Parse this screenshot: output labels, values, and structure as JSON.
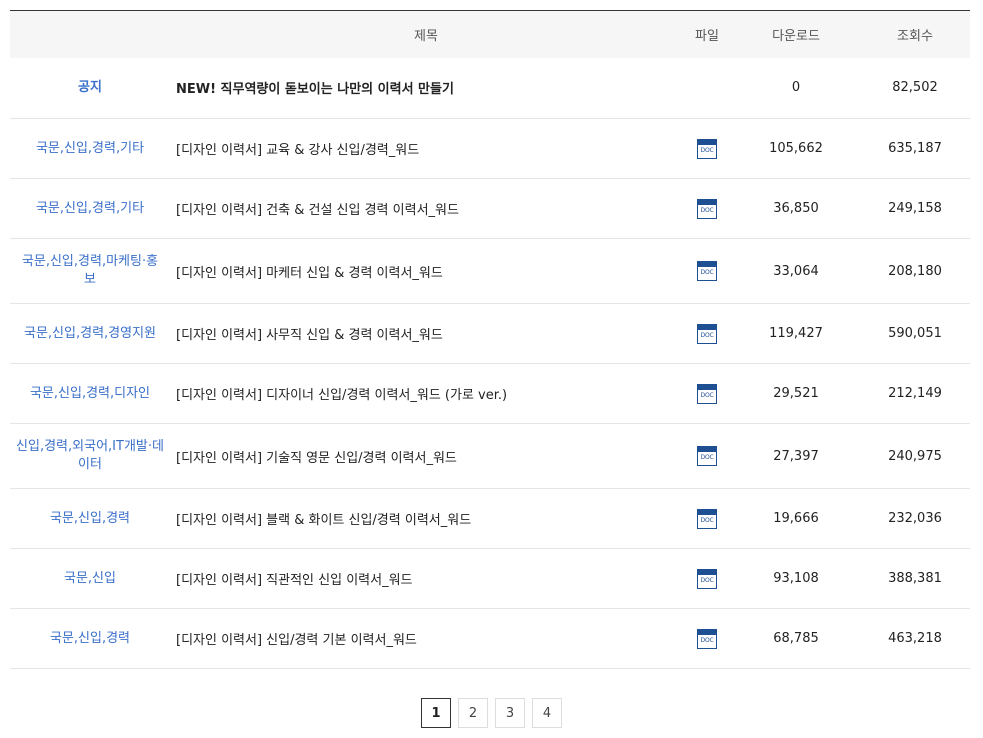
{
  "header": {
    "title": "제목",
    "file": "파일",
    "downloads": "다운로드",
    "views": "조회수"
  },
  "rows": [
    {
      "category": "공지",
      "title": "NEW! 직무역량이 돋보이는 나만의 이력서 만들기",
      "file": "",
      "downloads": "0",
      "views": "82,502"
    },
    {
      "category": "국문,신입,경력,기타",
      "title": "[디자인 이력서] 교육 & 강사 신입/경력_워드",
      "file": "DOC",
      "downloads": "105,662",
      "views": "635,187"
    },
    {
      "category": "국문,신입,경력,기타",
      "title": "[디자인 이력서] 건축 & 건설 신입 경력 이력서_워드",
      "file": "DOC",
      "downloads": "36,850",
      "views": "249,158"
    },
    {
      "category": "국문,신입,경력,마케팅·홍보",
      "title": "[디자인 이력서] 마케터 신입 & 경력 이력서_워드",
      "file": "DOC",
      "downloads": "33,064",
      "views": "208,180"
    },
    {
      "category": "국문,신입,경력,경영지원",
      "title": "[디자인 이력서] 사무직 신입 & 경력 이력서_워드",
      "file": "DOC",
      "downloads": "119,427",
      "views": "590,051"
    },
    {
      "category": "국문,신입,경력,디자인",
      "title": "[디자인 이력서] 디자이너 신입/경력 이력서_워드 (가로 ver.)",
      "file": "DOC",
      "downloads": "29,521",
      "views": "212,149"
    },
    {
      "category": "신입,경력,외국어,IT개발·데이터",
      "title": "[디자인 이력서] 기술직 영문 신입/경력 이력서_워드",
      "file": "DOC",
      "downloads": "27,397",
      "views": "240,975"
    },
    {
      "category": "국문,신입,경력",
      "title": "[디자인 이력서] 블랙 & 화이트 신입/경력 이력서_워드",
      "file": "DOC",
      "downloads": "19,666",
      "views": "232,036"
    },
    {
      "category": "국문,신입",
      "title": "[디자인 이력서] 직관적인 신입 이력서_워드",
      "file": "DOC",
      "downloads": "93,108",
      "views": "388,381"
    },
    {
      "category": "국문,신입,경력",
      "title": "[디자인 이력서] 신입/경력 기본 이력서_워드",
      "file": "DOC",
      "downloads": "68,785",
      "views": "463,218"
    }
  ],
  "pagination": {
    "pages": [
      "1",
      "2",
      "3",
      "4"
    ],
    "current": "1"
  },
  "colors": {
    "category": "#3a6fc9",
    "doc_icon": "#1e4f93"
  }
}
